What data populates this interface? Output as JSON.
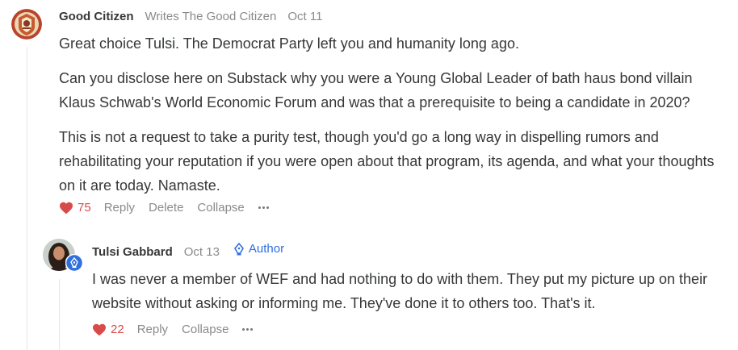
{
  "comment": {
    "author": "Good Citizen",
    "subtitle": "Writes The Good Citizen",
    "date": "Oct 11",
    "paragraphs": [
      "Great choice Tulsi. The Democrat Party left you and humanity long ago.",
      "Can you disclose here on Substack why you were a Young Global Leader of bath haus bond villain Klaus Schwab's World Economic Forum and was that a prerequisite to being a candidate in 2020?",
      "This is not a request to take a purity test, though you'd go a long way in dispelling rumors and rehabilitating your reputation if you were open about that program, its agenda, and what your thoughts on it are today. Namaste."
    ],
    "likes": "75",
    "actions": {
      "reply": "Reply",
      "delete": "Delete",
      "collapse": "Collapse"
    }
  },
  "reply": {
    "author": "Tulsi Gabbard",
    "date": "Oct 13",
    "badge": "Author",
    "paragraphs": [
      "I was never a member of WEF and had nothing to do with them. They put my picture up on their website without asking or informing me. They've done it to others too. That's it."
    ],
    "likes": "22",
    "actions": {
      "reply": "Reply",
      "collapse": "Collapse"
    }
  },
  "colors": {
    "accent": "#2f6fde",
    "like": "#d94a4a",
    "muted": "#8a8a8a",
    "text": "#363737"
  },
  "icons": {
    "like": "heart-icon",
    "more": "more-dots-icon",
    "author": "pen-nib-icon"
  }
}
